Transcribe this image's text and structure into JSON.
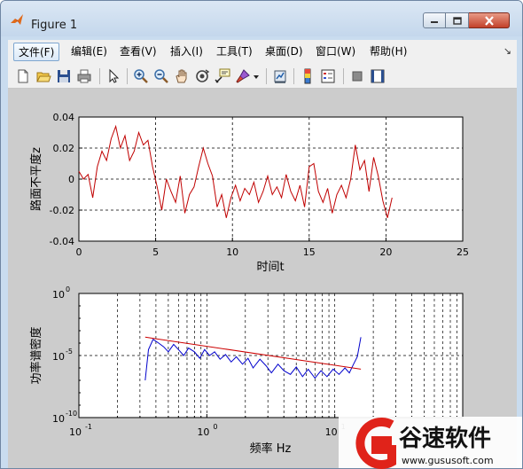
{
  "window": {
    "title": "Figure 1"
  },
  "menu": {
    "items": [
      {
        "label": "文件(F)"
      },
      {
        "label": "编辑(E)"
      },
      {
        "label": "查看(V)"
      },
      {
        "label": "插入(I)"
      },
      {
        "label": "工具(T)"
      },
      {
        "label": "桌面(D)"
      },
      {
        "label": "窗口(W)"
      },
      {
        "label": "帮助(H)"
      }
    ]
  },
  "toolbar": {
    "icons": [
      "new-figure-icon",
      "open-file-icon",
      "save-icon",
      "print-icon",
      "edit-plot-arrow-icon",
      "zoom-in-icon",
      "zoom-out-icon",
      "pan-icon",
      "rotate-3d-icon",
      "data-cursor-icon",
      "brush-icon",
      "brush-dropdown-icon",
      "link-plot-icon",
      "colorbar-icon",
      "legend-icon",
      "hide-plot-tools-icon",
      "show-plot-tools-icon"
    ]
  },
  "watermark": {
    "brand": "谷速软件",
    "url": "www.gususoft.com"
  },
  "chart_data": [
    {
      "type": "line",
      "xlabel": "时间t",
      "ylabel": "路面不平度z",
      "xlim": [
        0,
        25
      ],
      "ylim": [
        -0.04,
        0.04
      ],
      "xticks": [
        "0",
        "5",
        "10",
        "15",
        "20",
        "25"
      ],
      "yticks": [
        "-0.04",
        "-0.02",
        "0",
        "0.02",
        "0.04"
      ],
      "grid": "dashed",
      "series": [
        {
          "color": "#c00000",
          "x": [
            0,
            0.3,
            0.6,
            0.9,
            1.2,
            1.5,
            1.8,
            2.1,
            2.4,
            2.7,
            3.0,
            3.3,
            3.6,
            3.9,
            4.2,
            4.5,
            4.8,
            5.1,
            5.4,
            5.7,
            6.0,
            6.3,
            6.6,
            6.9,
            7.2,
            7.5,
            7.8,
            8.1,
            8.4,
            8.7,
            9.0,
            9.3,
            9.6,
            9.9,
            10.2,
            10.5,
            10.8,
            11.1,
            11.4,
            11.7,
            12.0,
            12.3,
            12.6,
            12.9,
            13.2,
            13.5,
            13.8,
            14.1,
            14.4,
            14.7,
            15.0,
            15.3,
            15.6,
            15.9,
            16.2,
            16.5,
            16.8,
            17.1,
            17.4,
            17.7,
            18.0,
            18.3,
            18.6,
            18.9,
            19.2,
            19.5,
            19.8,
            20.1,
            20.4
          ],
          "y": [
            0.005,
            0.0,
            0.003,
            -0.012,
            0.008,
            0.018,
            0.012,
            0.026,
            0.034,
            0.02,
            0.028,
            0.012,
            0.018,
            0.03,
            0.022,
            0.025,
            0.008,
            -0.005,
            -0.02,
            0.0,
            -0.008,
            -0.015,
            0.002,
            -0.022,
            -0.01,
            -0.005,
            0.008,
            0.02,
            0.01,
            0.002,
            -0.018,
            -0.01,
            -0.025,
            -0.012,
            -0.004,
            -0.014,
            -0.006,
            -0.01,
            -0.002,
            -0.015,
            -0.008,
            0.002,
            -0.01,
            -0.005,
            -0.012,
            0.003,
            -0.008,
            -0.014,
            -0.004,
            -0.018,
            0.008,
            0.01,
            -0.008,
            -0.015,
            -0.006,
            -0.022,
            -0.01,
            -0.004,
            -0.012,
            0.0,
            0.022,
            0.006,
            0.012,
            -0.008,
            0.014,
            0.002,
            -0.014,
            -0.025,
            -0.012
          ]
        }
      ]
    },
    {
      "type": "line",
      "xlabel": "频率 Hz",
      "ylabel": "功率谱密度",
      "xscale": "log",
      "yscale": "log",
      "xlim": [
        0.1,
        100
      ],
      "ylim": [
        1e-10,
        1
      ],
      "xticks": [
        "10^-1",
        "10^0",
        "10^1"
      ],
      "yticks": [
        "10^-10",
        "10^-5",
        "10^0"
      ],
      "grid": "dashed",
      "series": [
        {
          "color": "#0000cc",
          "x": [
            0.33,
            0.35,
            0.38,
            0.42,
            0.46,
            0.5,
            0.55,
            0.6,
            0.66,
            0.72,
            0.8,
            0.88,
            0.96,
            1.05,
            1.15,
            1.27,
            1.4,
            1.55,
            1.7,
            1.9,
            2.1,
            2.3,
            2.6,
            2.9,
            3.2,
            3.6,
            4.0,
            4.5,
            5.0,
            5.6,
            6.2,
            7.0,
            7.8,
            8.7,
            9.7,
            10.8,
            12.0,
            13.0,
            14.0,
            15.0,
            16.0
          ],
          "y": [
            1e-07,
            3e-05,
            0.0002,
            0.0001,
            5e-05,
            2e-05,
            8e-05,
            3e-05,
            1e-05,
            4e-05,
            2e-05,
            6e-06,
            3e-05,
            1e-05,
            2e-05,
            5e-06,
            1.2e-05,
            3e-06,
            8e-06,
            2e-06,
            6e-06,
            1e-06,
            5e-06,
            1.5e-06,
            4e-07,
            2e-06,
            6e-07,
            3e-07,
            1.2e-06,
            2e-07,
            8e-07,
            1.5e-07,
            6e-07,
            2e-07,
            8e-07,
            3e-07,
            1e-06,
            4e-07,
            2e-06,
            8e-06,
            0.0003
          ]
        },
        {
          "color": "#cc0000",
          "x": [
            0.33,
            16.0
          ],
          "y": [
            0.0003,
            8e-07
          ]
        }
      ]
    }
  ]
}
